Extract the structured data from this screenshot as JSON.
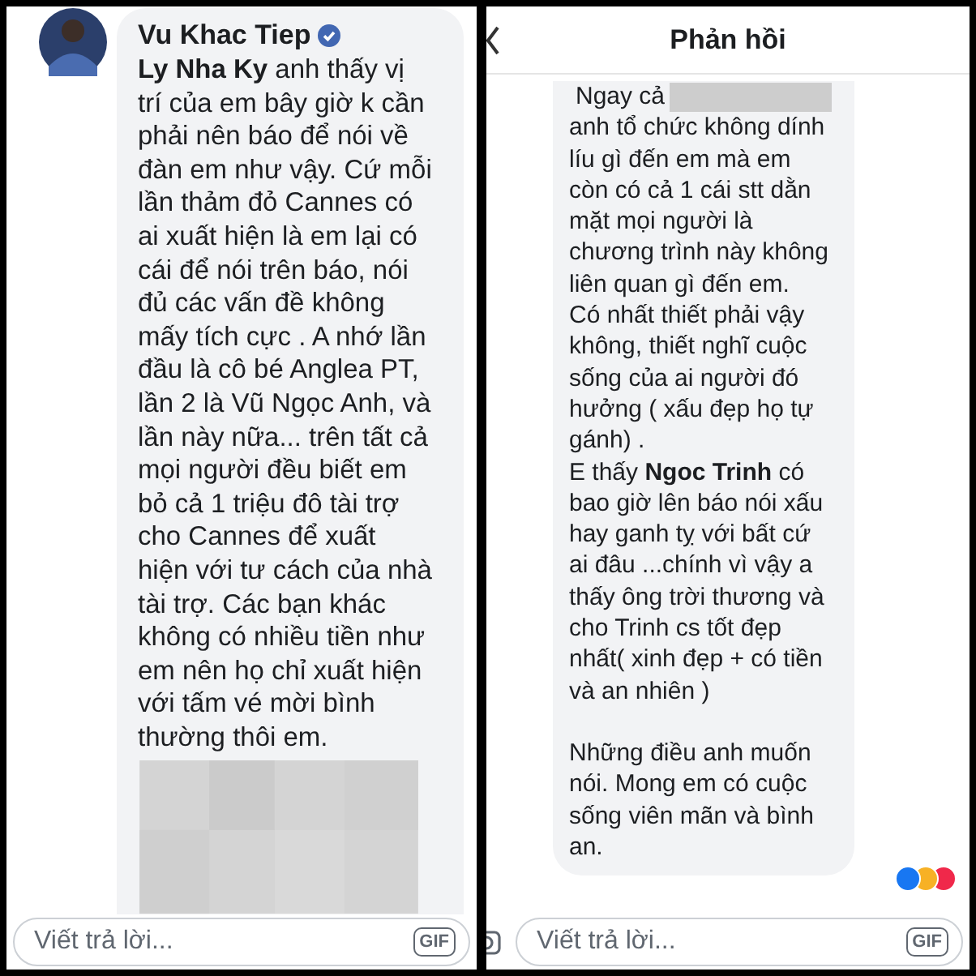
{
  "left_panel": {
    "author": "Vu Khac Tiep",
    "verified": true,
    "comment": "**Ly Nha Ky**  anh thấy vị\ntrí của em bây giờ k cần\nphải nên báo để nói về\nđàn em như vậy. Cứ mỗi\nlần thảm đỏ Cannes có\nai xuất hiện là em lại có\ncái để nói trên báo, nói\nđủ các vấn đề không\nmấy tích cực . A nhớ lần\nđầu là cô bé Anglea PT,\nlần 2 là Vũ Ngọc Anh, và\nlần này nữa... trên tất cả\nmọi người đều biết em\nbỏ cả 1 triệu đô tài trợ\ncho Cannes để xuất\nhiện với tư cách của nhà\ntài trợ. Các bạn khác\nkhông có nhiều tiền như\nem nên họ chỉ xuất hiện\nvới tấm vé mời bình\nthường thôi em.",
    "reply_field": {
      "placeholder": "Viết trả lời..."
    },
    "gif_button": "GIF"
  },
  "right_panel": {
    "title": "Phản hồi",
    "comment_start": "Ngay cả",
    "comment": "anh tổ chức không dính\nlíu gì đến em mà em\ncòn có cả 1 cái stt dằn\nmặt mọi người là\nchương trình này không\nliên quan gì đến em.\nCó nhất thiết phải vậy\nkhông, thiết nghĩ cuộc\nsống của ai người đó\nhưởng ( xấu đẹp họ tự\ngánh) .\nE thấy **Ngoc Trinh** có\nbao giờ lên báo nói xấu\nhay ganh tỵ với bất cứ\nai đâu ...chính vì vậy a\nthấy ông trời thương và\ncho Trinh cs tốt đẹp\nnhất( xinh đẹp + có tiền\nvà an nhiên )",
    "closing": "Những điều anh muốn\nnói. Mong em có cuộc\nsống viên mãn và bình\nan.",
    "reply_field": {
      "placeholder": "Viết trả lời..."
    },
    "gif_button": "GIF"
  }
}
